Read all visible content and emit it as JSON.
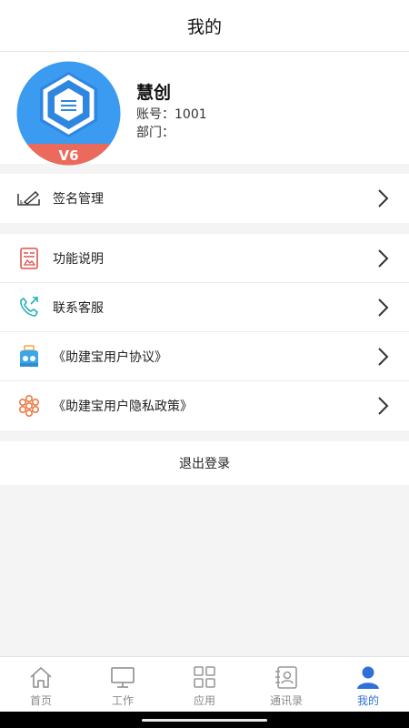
{
  "header": {
    "title": "我的"
  },
  "profile": {
    "name": "慧创",
    "account_line": "账号：1001",
    "department_line": "部门：",
    "avatar_badge": "V6"
  },
  "menu_signature": {
    "label": "签名管理",
    "icon": "signature-pen-icon"
  },
  "menu_items": [
    {
      "label": "功能说明",
      "icon": "document-icon"
    },
    {
      "label": "联系客服",
      "icon": "phone-icon"
    },
    {
      "label": "《助建宝用户协议》",
      "icon": "agreement-icon"
    },
    {
      "label": "《助建宝用户隐私政策》",
      "icon": "privacy-policy-icon"
    }
  ],
  "logout": {
    "label": "退出登录"
  },
  "tabbar": {
    "items": [
      {
        "label": "首页",
        "icon": "home-icon",
        "active": false
      },
      {
        "label": "工作",
        "icon": "monitor-icon",
        "active": false
      },
      {
        "label": "应用",
        "icon": "grid-icon",
        "active": false
      },
      {
        "label": "通讯录",
        "icon": "contacts-icon",
        "active": false
      },
      {
        "label": "我的",
        "icon": "person-icon",
        "active": true
      }
    ]
  },
  "colors": {
    "accent_blue": "#2e6fd8",
    "avatar_blue": "#3a9bf0",
    "badge_red": "#ec6a5c",
    "icon_red": "#e0524b",
    "icon_teal": "#26b2b5",
    "icon_orange": "#ee7a47"
  }
}
